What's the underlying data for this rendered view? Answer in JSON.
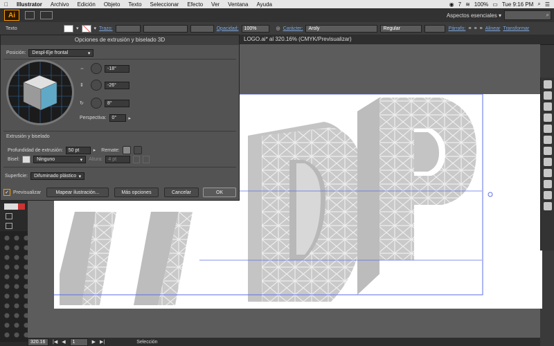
{
  "menubar": {
    "apple": "",
    "app": "Illustrator",
    "items": [
      "Archivo",
      "Edición",
      "Objeto",
      "Texto",
      "Seleccionar",
      "Efecto",
      "Ver",
      "Ventana",
      "Ayuda"
    ],
    "badge": "7",
    "battery": "100%",
    "clock": "Tue 9:16 PM"
  },
  "appbar": {
    "logo": "Ai",
    "workspace": "Aspectos esenciales ▾"
  },
  "ctrlbar": {
    "type_label": "Texto",
    "stroke_label": "Trazo:",
    "opacity_label": "Opacidad:",
    "opacity_value": "100%",
    "char_label": "Carácter:",
    "font": "Aroly",
    "style": "Regular",
    "para_label": "Párrafo:",
    "align_label": "Alinear",
    "transform_label": "Transformar"
  },
  "document": {
    "tab": "LOGO.ai* al 320.16% (CMYK/Previsualizar)"
  },
  "dialog": {
    "title": "Opciones de extrusión y biselado 3D",
    "position_label": "Posición:",
    "position_value": "Despl-Eje frontal",
    "rot_x": "-18°",
    "rot_y": "-26°",
    "rot_z": "8°",
    "perspective_label": "Perspectiva:",
    "perspective_value": "0°",
    "extrude_section": "Extrusión y biselado",
    "depth_label": "Profundidad de extrusión:",
    "depth_value": "50 pt",
    "cap_label": "Remate:",
    "bevel_label": "Bisel:",
    "bevel_value": "Ninguno",
    "height_label": "Altura:",
    "height_value": "4 pt",
    "surface_label": "Superficie:",
    "surface_value": "Difuminado plástico",
    "preview_label": "Previsualizar",
    "preview_checked": true,
    "map_button": "Mapear ilustración...",
    "more_button": "Más opciones",
    "cancel_button": "Cancelar",
    "ok_button": "OK"
  },
  "statusbar": {
    "zoom": "320.16",
    "page": "1",
    "tool": "Selección"
  },
  "colors": {
    "accent": "#ff9a00",
    "guide": "#5b6ee8",
    "cube_face": "#5fa9c7"
  }
}
